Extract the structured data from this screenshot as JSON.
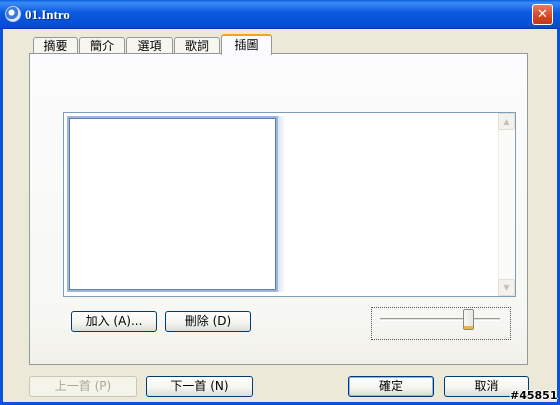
{
  "window": {
    "title": "01.Intro",
    "close_glyph": "✕"
  },
  "tabs": [
    {
      "label": "摘要",
      "active": false
    },
    {
      "label": "簡介",
      "active": false
    },
    {
      "label": "選項",
      "active": false
    },
    {
      "label": "歌詞",
      "active": false
    },
    {
      "label": "插圖",
      "active": true
    }
  ],
  "artwork": {
    "add_button": "加入 (A)...",
    "delete_button": "刪除 (D)",
    "size_slider_fraction": 0.74
  },
  "footer": {
    "prev_button": "上一首 (P)",
    "next_button": "下一首 (N)",
    "ok_button": "確定",
    "cancel_button": "取消"
  },
  "watermark": "#45851",
  "colors": {
    "accent": "#0b54d6",
    "tab_highlight": "#f3a226",
    "slider_thumb_accent": "#f2b33d"
  }
}
